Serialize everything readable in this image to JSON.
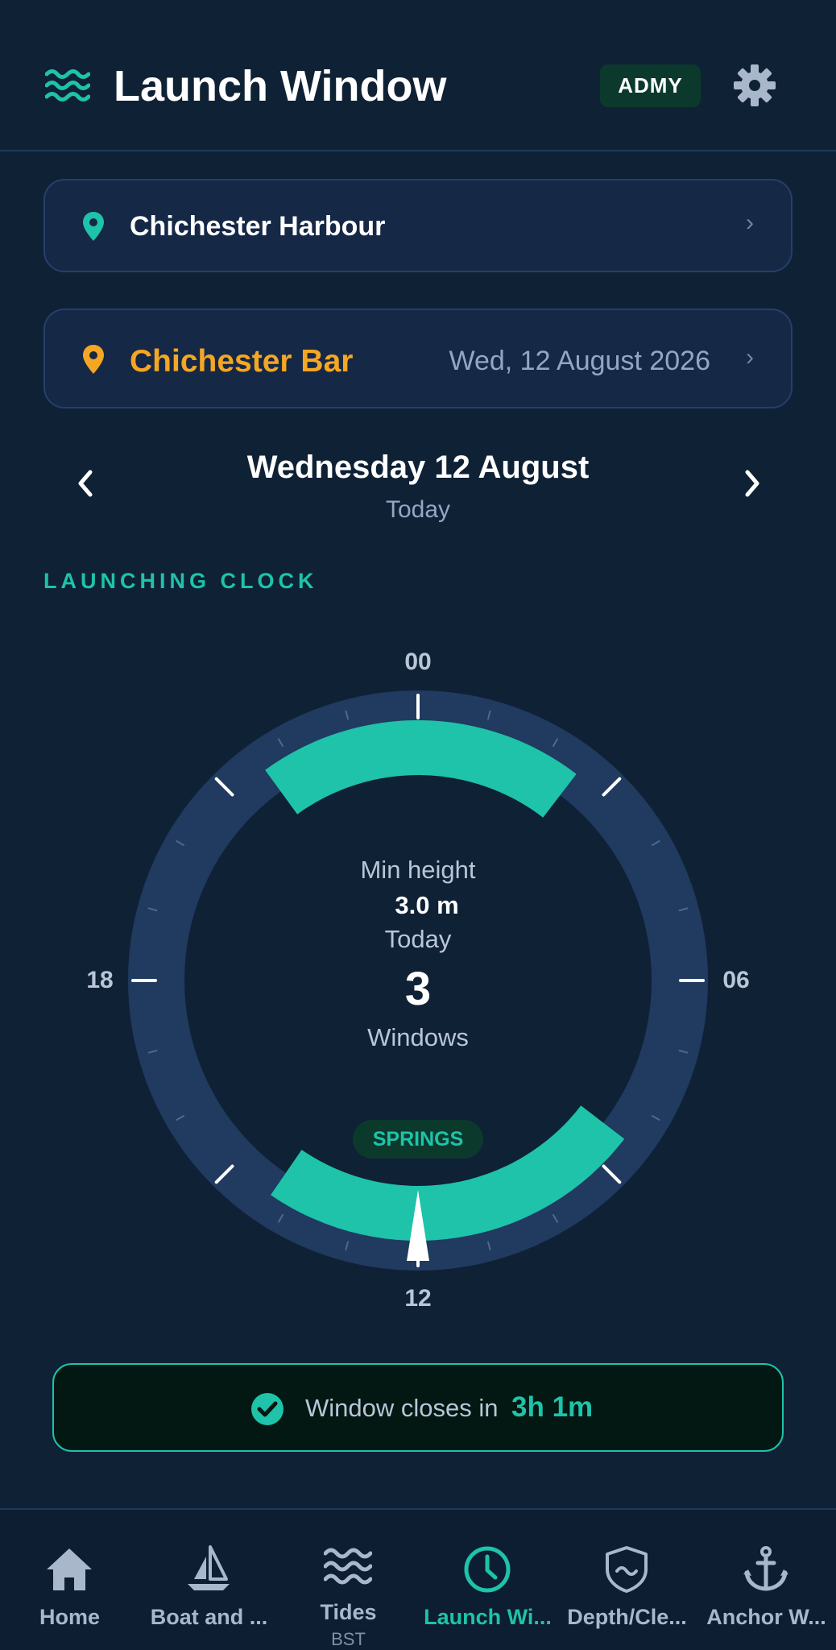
{
  "header": {
    "title": "Launch Window",
    "badge": "ADMY"
  },
  "location_card": {
    "label": "Chichester Harbour"
  },
  "station_card": {
    "label": "Chichester Bar",
    "date": "Wed, 12 August 2026"
  },
  "date_nav": {
    "day": "Wednesday 12 August",
    "sub": "Today"
  },
  "section": {
    "title": "LAUNCHING CLOCK"
  },
  "clock": {
    "hour_labels": {
      "top": "00",
      "right": "06",
      "bottom": "12",
      "left": "18"
    },
    "min_height_label": "Min height",
    "min_height_value": "3.0 m",
    "today_label": "Today",
    "window_count": "3",
    "windows_label": "Windows",
    "tide_badge": "SPRINGS",
    "windows_hours": [
      [
        21.6,
        2.5
      ],
      [
        8.5,
        14.3
      ]
    ],
    "current_hour": 12.0
  },
  "status": {
    "text": "Window closes in",
    "time": "3h 1m"
  },
  "nav": {
    "items": [
      {
        "label": "Home",
        "icon": "home-icon"
      },
      {
        "label": "Boat and ...",
        "icon": "sailboat-icon"
      },
      {
        "label": "Tides",
        "sub": "BST",
        "icon": "waves-icon"
      },
      {
        "label": "Launch Wi...",
        "icon": "clock-icon",
        "active": true
      },
      {
        "label": "Depth/Cle...",
        "icon": "shield-wave-icon"
      },
      {
        "label": "Anchor W...",
        "icon": "anchor-icon"
      }
    ]
  },
  "colors": {
    "accent": "#1ec3a9",
    "orange": "#f5a623",
    "background": "#0f2135",
    "ring": "#203a60"
  }
}
